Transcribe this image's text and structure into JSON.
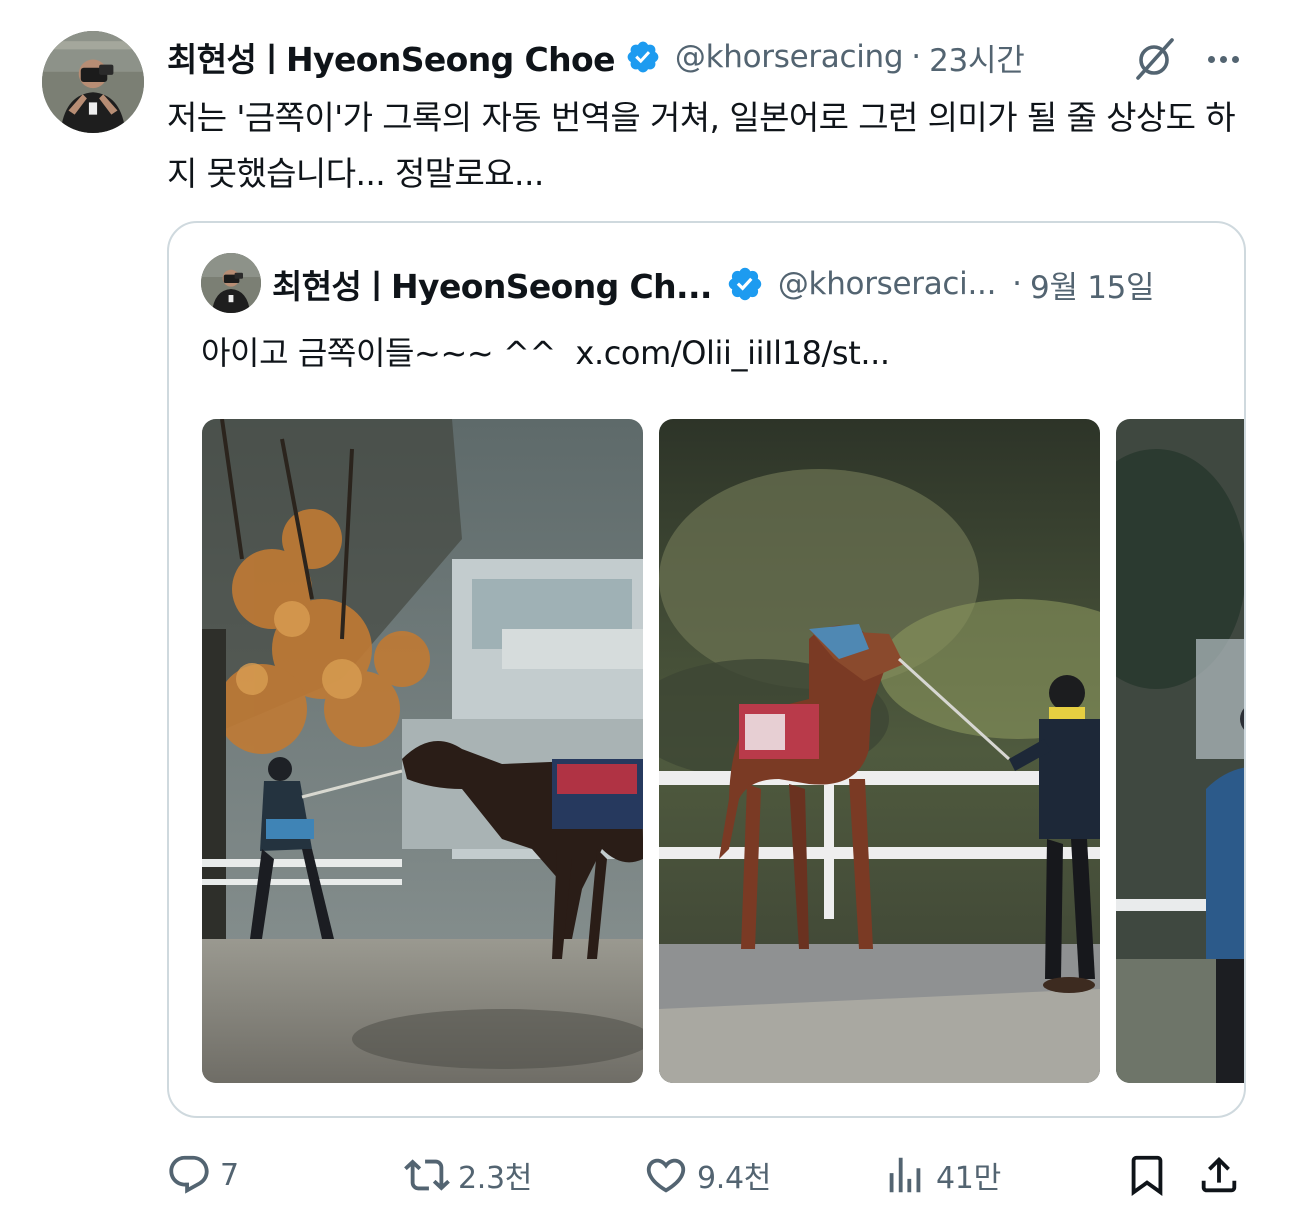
{
  "tweet": {
    "author_name": "최현성ㅣHyeonSeong Choe",
    "handle": "@khorseracing",
    "separator": "·",
    "time": "23시간",
    "text": "저는 '금쪽이'가 그록의 자동 번역을 거쳐, 일본어로 그런 의미가 될 줄 상상도 하지 못했습니다... 정말로요..."
  },
  "quoted_tweet": {
    "author_name": "최현성ㅣHyeonSeong Ch...",
    "handle": "@khorseraci...",
    "separator": "·",
    "time": "9월 15일",
    "text": "아이고 금쪽이들~~~ ^^  x.com/Olii_iiIl18/st..."
  },
  "actions": {
    "reply_count": "7",
    "repost_count": "2.3천",
    "like_count": "9.4천",
    "views_count": "41만"
  },
  "icons": {
    "verified": "verified-badge-icon",
    "grok": "grok-icon",
    "more": "more-options-icon",
    "reply": "reply-icon",
    "repost": "repost-icon",
    "like": "heart-icon",
    "views": "views-chart-icon",
    "bookmark": "bookmark-icon",
    "share": "share-icon"
  },
  "colors": {
    "verified_blue": "#1d9bf0",
    "secondary_text": "#536471",
    "primary_text": "#0f1419",
    "border": "#cfd9de"
  }
}
